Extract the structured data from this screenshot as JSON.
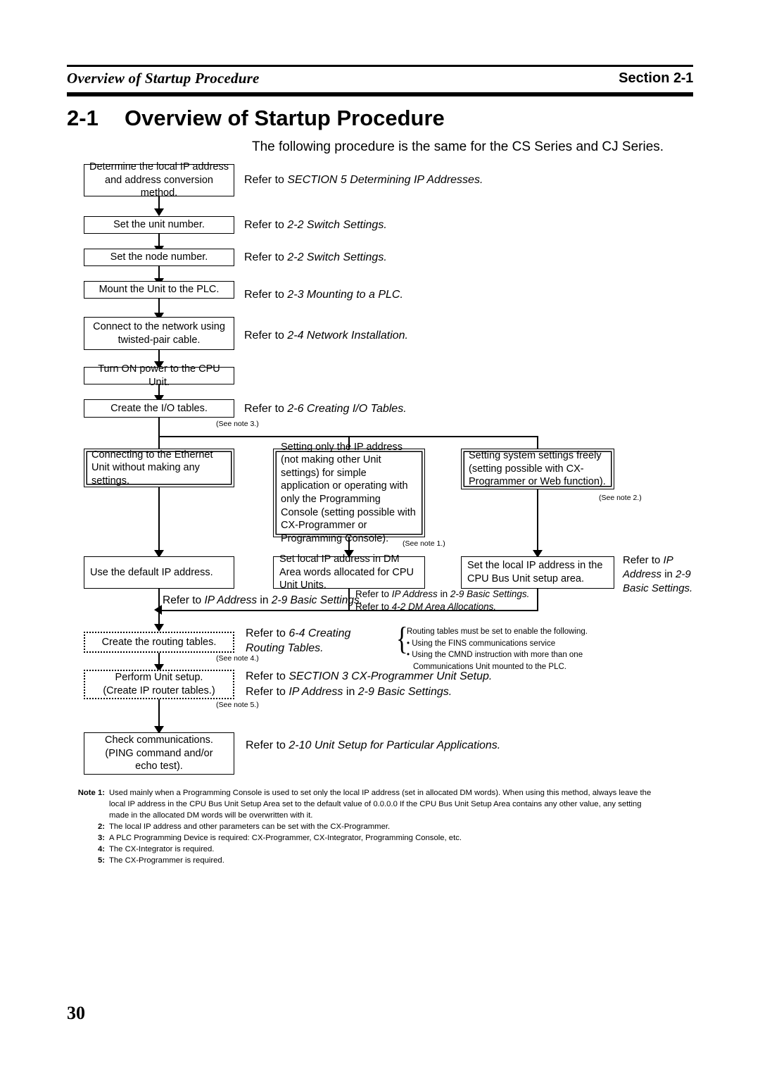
{
  "header": {
    "left_title": "Overview of Startup Procedure",
    "right_label": "Section",
    "right_number": "2-1"
  },
  "section": {
    "number": "2-1",
    "title": "Overview of Startup Procedure",
    "intro": "The following procedure is the same for the CS Series and CJ Series."
  },
  "flow": {
    "step1": "Determine the local IP address and address conversion method.",
    "step2": "Set the unit number.",
    "step3": "Set the node number.",
    "step4": "Mount the Unit to the PLC.",
    "step5": "Connect to the network using twisted-pair cable.",
    "step6": "Turn ON power to the CPU Unit.",
    "step7": "Create the I/O tables.",
    "branch_a": "Connecting to the Ethernet Unit without making any settings.",
    "branch_b": "Setting only the IP address (not making other Unit settings) for simple application or operating with only the Programming Console (setting possible with CX-Programmer or Programming Console).",
    "branch_c": "Setting system settings freely (setting possible with CX-Programmer or Web function).",
    "result_a": "Use the default IP address.",
    "result_b": "Set local IP address in DM Area words allocated for CPU Unit Units.",
    "result_c": "Set the local IP address in the CPU Bus Unit setup area.",
    "routing": "Create the routing tables.",
    "unitsetup_line1": "Perform Unit setup.",
    "unitsetup_line2": "(Create IP router tables.)",
    "check_line1": "Check communications.",
    "check_line2": "(PING command and/or",
    "check_line3": "echo test)."
  },
  "refs": {
    "r1_plain": "Refer to ",
    "r1_italic": "SECTION 5 Determining IP Addresses.",
    "r2_italic": "2-2 Switch Settings.",
    "r3_italic": "2-2 Switch Settings.",
    "r4_italic": "2-3 Mounting to a PLC.",
    "r5_italic": "2-4 Network Installation.",
    "r7_italic": "2-6 Creating I/O Tables.",
    "ra_ital1": "IP Address",
    "ra_mid": " in ",
    "ra_ital2": "2-9 Basic Settings.",
    "rb_line1_ital1": "IP Address",
    "rb_line1_ital2": "2-9 Basic Settings.",
    "rb_line2_ital": "4-2 DM Area Allocations.",
    "rc_line1": "Refer to ",
    "rc_ital1": "IP",
    "rc_line2_ital": "Address",
    "rc_line2_mid": " in ",
    "rc_line2_ital2": "2-9",
    "rc_line3_ital": "Basic Settings.",
    "rrt_ital": "6-4 Creating Routing Tables.",
    "rus_line1_ital": "SECTION 3 CX-Programmer Unit Setup.",
    "rus_line2_ital1": "IP Address",
    "rus_line2_ital2": "2-9 Basic Settings.",
    "rchk_ital": "2-10 Unit Setup for Particular Applications."
  },
  "seenotes": {
    "n3": "(See note 3.)",
    "n1": "(See note 1.)",
    "n2": "(See note 2.)",
    "n4": "(See note 4.)",
    "n5": "(See note 5.)"
  },
  "bracket_note": {
    "line1": "Routing tables must be set to enable the following.",
    "line2": "• Using the FINS communications service",
    "line3": "• Using the CMND instruction with more than one",
    "line4": "Communications Unit mounted to the PLC."
  },
  "notes": {
    "label_note": "Note",
    "items": [
      {
        "num": "1:",
        "text": "Used mainly when a Programming Console is used to set only the local IP address (set in allocated DM words). When using this method, always leave the local IP address in the CPU Bus Unit Setup Area set to the default value of 0.0.0.0 If the CPU Bus Unit Setup Area contains any other value, any setting made in the allocated DM words will be overwritten with it."
      },
      {
        "num": "2:",
        "text": "The local IP address and other parameters can be set with the CX-Programmer."
      },
      {
        "num": "3:",
        "text": "A PLC Programming Device is required: CX-Programmer, CX-Integrator, Programming Console, etc."
      },
      {
        "num": "4:",
        "text": "The CX-Integrator is required."
      },
      {
        "num": "5:",
        "text": "The CX-Programmer is required."
      }
    ]
  },
  "footer": {
    "page_number": "30"
  }
}
